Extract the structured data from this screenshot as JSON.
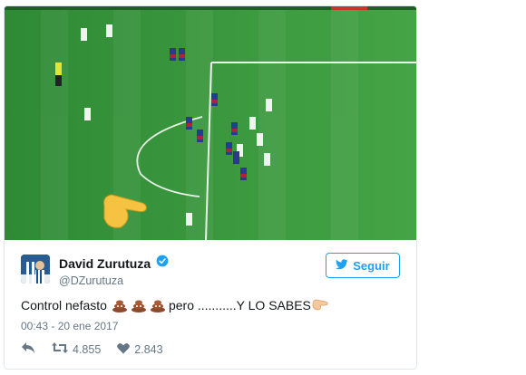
{
  "tweet": {
    "display_name": "David Zurutuza",
    "handle": "@DZurutuza",
    "follow_label": "Seguir",
    "text_before": "Control nefasto",
    "text_middle": "pero ...........Y LO SABES",
    "timestamp": "00:43 - 20 ene 2017",
    "retweet_count": "4.855",
    "like_count": "2.843"
  },
  "colors": {
    "accent": "#1da1f2",
    "pitch": "#3c9a3e",
    "text_muted": "#657786"
  },
  "icons": {
    "verified": "verified-badge-icon",
    "follow": "twitter-bird-icon",
    "reply": "reply-icon",
    "retweet": "retweet-icon",
    "like": "heart-icon",
    "pointing": "pointing-hand-emoji",
    "poop": "pile-of-poo-emoji"
  }
}
